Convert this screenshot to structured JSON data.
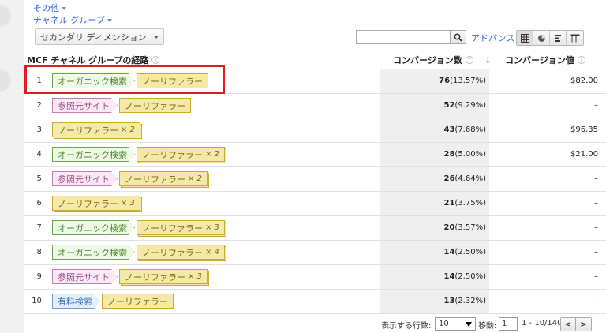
{
  "links": {
    "other": "その他",
    "channel_group": "チャネル グループ"
  },
  "toolbar": {
    "secondary_dimension": "セカンダリ ディメンション",
    "search_value": "",
    "advanced": "アドバンス"
  },
  "table": {
    "columns": {
      "path": "MCF チャネル グループの経路",
      "conversions": "コンバージョン数",
      "value": "コンバージョン値"
    },
    "sort_arrow": "↓",
    "rows": [
      {
        "num": "1.",
        "chips": [
          {
            "label": "オーガニック検索",
            "type": "organic",
            "mult": ""
          },
          {
            "label": "ノーリファラー",
            "type": "referrer",
            "mult": ""
          }
        ],
        "conv": "76",
        "pct": "(13.57%)",
        "value": "$82.00"
      },
      {
        "num": "2.",
        "chips": [
          {
            "label": "参照元サイト",
            "type": "referral",
            "mult": ""
          },
          {
            "label": "ノーリファラー",
            "type": "referrer",
            "mult": ""
          }
        ],
        "conv": "52",
        "pct": "(9.29%)",
        "value": "–"
      },
      {
        "num": "3.",
        "chips": [
          {
            "label": "ノーリファラー",
            "type": "referrer",
            "mult": "× 2"
          }
        ],
        "conv": "43",
        "pct": "(7.68%)",
        "value": "$96.35"
      },
      {
        "num": "4.",
        "chips": [
          {
            "label": "オーガニック検索",
            "type": "organic",
            "mult": ""
          },
          {
            "label": "ノーリファラー",
            "type": "referrer",
            "mult": "× 2"
          }
        ],
        "conv": "28",
        "pct": "(5.00%)",
        "value": "$21.00"
      },
      {
        "num": "5.",
        "chips": [
          {
            "label": "参照元サイト",
            "type": "referral",
            "mult": ""
          },
          {
            "label": "ノーリファラー",
            "type": "referrer",
            "mult": "× 2"
          }
        ],
        "conv": "26",
        "pct": "(4.64%)",
        "value": "–"
      },
      {
        "num": "6.",
        "chips": [
          {
            "label": "ノーリファラー",
            "type": "referrer",
            "mult": "× 3"
          }
        ],
        "conv": "21",
        "pct": "(3.75%)",
        "value": "–"
      },
      {
        "num": "7.",
        "chips": [
          {
            "label": "オーガニック検索",
            "type": "organic",
            "mult": ""
          },
          {
            "label": "ノーリファラー",
            "type": "referrer",
            "mult": "× 3"
          }
        ],
        "conv": "20",
        "pct": "(3.57%)",
        "value": "–"
      },
      {
        "num": "8.",
        "chips": [
          {
            "label": "オーガニック検索",
            "type": "organic",
            "mult": ""
          },
          {
            "label": "ノーリファラー",
            "type": "referrer",
            "mult": "× 4"
          }
        ],
        "conv": "14",
        "pct": "(2.50%)",
        "value": "–"
      },
      {
        "num": "9.",
        "chips": [
          {
            "label": "参照元サイト",
            "type": "referral",
            "mult": ""
          },
          {
            "label": "ノーリファラー",
            "type": "referrer",
            "mult": "× 3"
          }
        ],
        "conv": "14",
        "pct": "(2.50%)",
        "value": "–"
      },
      {
        "num": "10.",
        "chips": [
          {
            "label": "有料検索",
            "type": "paid",
            "mult": ""
          },
          {
            "label": "ノーリファラー",
            "type": "referrer",
            "mult": ""
          }
        ],
        "conv": "13",
        "pct": "(2.32%)",
        "value": "–"
      }
    ]
  },
  "footer": {
    "rows_label": "表示する行数:",
    "rows_value": "10",
    "goto_label": "移動:",
    "goto_value": "1",
    "range": "1 - 10/140",
    "prev": "<",
    "next": ">"
  },
  "colors": {
    "highlight": "#e01b24",
    "link": "#3367d6",
    "organic": "#6aa84f",
    "referral": "#c87eb2",
    "paid": "#6b9ed6",
    "referrer": "#c9ab34"
  },
  "icons": {
    "search": "search-icon",
    "views": [
      "table-view-icon",
      "pie-view-icon",
      "bar-view-icon",
      "pivot-view-icon"
    ]
  }
}
